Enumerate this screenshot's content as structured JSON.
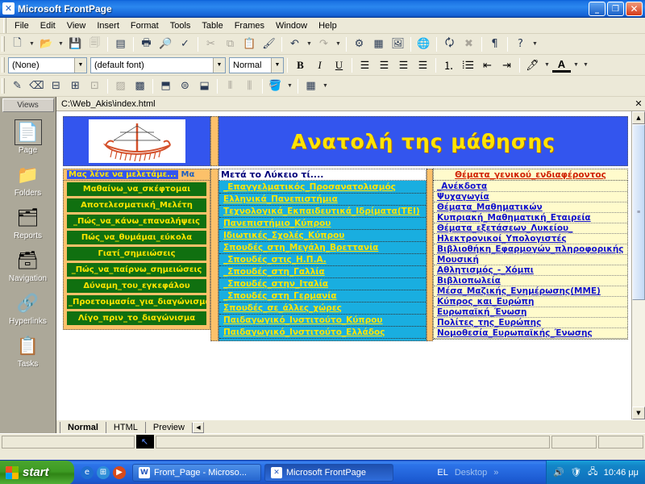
{
  "window": {
    "title": "Microsoft FrontPage",
    "icon": "frontpage-icon",
    "minimize": "_",
    "maximize": "❐",
    "close": "✕"
  },
  "menubar": {
    "items": [
      "File",
      "Edit",
      "View",
      "Insert",
      "Format",
      "Tools",
      "Table",
      "Frames",
      "Window",
      "Help"
    ]
  },
  "standard_toolbar": {
    "buttons": [
      {
        "name": "new-page-button",
        "glyph": "🗋"
      },
      {
        "name": "new-page-dropdown",
        "glyph": "▾"
      },
      {
        "name": "open-button",
        "glyph": "📂"
      },
      {
        "name": "open-dropdown",
        "glyph": "▾"
      },
      {
        "name": "save-button",
        "glyph": "💾"
      },
      {
        "name": "publish-button",
        "glyph": "🗐"
      },
      {
        "name": "folder-list-button",
        "glyph": "▤"
      },
      {
        "name": "print-button",
        "glyph": "🖨"
      },
      {
        "name": "print-preview-button",
        "glyph": "🔍"
      },
      {
        "name": "spelling-button",
        "glyph": "ABC"
      },
      {
        "name": "cut-button",
        "glyph": "✂"
      },
      {
        "name": "copy-button",
        "glyph": "⧉"
      },
      {
        "name": "paste-button",
        "glyph": "📋"
      },
      {
        "name": "format-painter-button",
        "glyph": "🖌"
      },
      {
        "name": "undo-button",
        "glyph": "↶"
      },
      {
        "name": "undo-dropdown",
        "glyph": "▾"
      },
      {
        "name": "redo-button",
        "glyph": "↷"
      },
      {
        "name": "redo-dropdown",
        "glyph": "▾"
      },
      {
        "name": "insert-component-button",
        "glyph": "⚙"
      },
      {
        "name": "insert-table-button",
        "glyph": "▦"
      },
      {
        "name": "insert-picture-button",
        "glyph": "🖼"
      },
      {
        "name": "hyperlink-button",
        "glyph": "🌐"
      },
      {
        "name": "refresh-button",
        "glyph": "🗘"
      },
      {
        "name": "stop-button",
        "glyph": "✖"
      },
      {
        "name": "show-paragraph-marks-button",
        "glyph": "¶"
      },
      {
        "name": "help-button",
        "glyph": "?"
      },
      {
        "name": "toolbar-options-dropdown",
        "glyph": "▾"
      }
    ]
  },
  "formatting_toolbar": {
    "style_combo": {
      "value": "(None)",
      "arrow": "▾"
    },
    "font_combo": {
      "value": "(default font)",
      "arrow": "▾"
    },
    "size_combo": {
      "value": "Normal",
      "arrow": "▾"
    },
    "buttons": [
      {
        "name": "bold-button",
        "glyph": "B"
      },
      {
        "name": "italic-button",
        "glyph": "I"
      },
      {
        "name": "underline-button",
        "glyph": "U"
      },
      {
        "name": "align-left-button",
        "glyph": "≡"
      },
      {
        "name": "align-center-button",
        "glyph": "≡"
      },
      {
        "name": "align-right-button",
        "glyph": "≡"
      },
      {
        "name": "justify-button",
        "glyph": "≡"
      },
      {
        "name": "numbered-list-button",
        "glyph": "⒈"
      },
      {
        "name": "bulleted-list-button",
        "glyph": "☰"
      },
      {
        "name": "decrease-indent-button",
        "glyph": "⇤"
      },
      {
        "name": "increase-indent-button",
        "glyph": "⇥"
      },
      {
        "name": "highlight-button",
        "glyph": "🖊"
      },
      {
        "name": "highlight-dropdown",
        "glyph": "▾"
      },
      {
        "name": "font-color-button",
        "glyph": "A"
      },
      {
        "name": "font-color-dropdown",
        "glyph": "▾"
      },
      {
        "name": "formatting-options-dropdown",
        "glyph": "▾"
      }
    ]
  },
  "tables_toolbar": {
    "buttons": [
      {
        "name": "draw-table-button",
        "glyph": "✎"
      },
      {
        "name": "eraser-button",
        "glyph": "⌫"
      },
      {
        "name": "insert-rows-button",
        "glyph": "⊟"
      },
      {
        "name": "insert-columns-button",
        "glyph": "⊞"
      },
      {
        "name": "delete-cells-button",
        "glyph": "⊠"
      },
      {
        "name": "merge-cells-button",
        "glyph": "▨"
      },
      {
        "name": "split-cells-button",
        "glyph": "▩"
      },
      {
        "name": "align-top-button",
        "glyph": "⬒"
      },
      {
        "name": "center-vertically-button",
        "glyph": "⬓"
      },
      {
        "name": "align-bottom-button",
        "glyph": "⬓"
      },
      {
        "name": "distribute-rows-button",
        "glyph": "⫴"
      },
      {
        "name": "distribute-columns-button",
        "glyph": "⫼"
      },
      {
        "name": "fill-color-button",
        "glyph": "🪣"
      },
      {
        "name": "fill-color-dropdown",
        "glyph": "▾"
      },
      {
        "name": "table-autoformat-button",
        "glyph": "▦"
      },
      {
        "name": "table-autoformat-dropdown",
        "glyph": "▾"
      }
    ]
  },
  "views_bar": {
    "caption": "Views",
    "items": [
      {
        "label": "Page",
        "icon": "page-view-icon",
        "glyph": "📄",
        "selected": true
      },
      {
        "label": "Folders",
        "icon": "folders-view-icon",
        "glyph": "📁",
        "selected": false
      },
      {
        "label": "Reports",
        "icon": "reports-view-icon",
        "glyph": "🗂",
        "selected": false
      },
      {
        "label": "Navigation",
        "icon": "navigation-view-icon",
        "glyph": "🗃",
        "selected": false
      },
      {
        "label": "Hyperlinks",
        "icon": "hyperlinks-view-icon",
        "glyph": "🔗",
        "selected": false
      },
      {
        "label": "Tasks",
        "icon": "tasks-view-icon",
        "glyph": "📋",
        "selected": false
      }
    ]
  },
  "document": {
    "path": "C:\\Web_Akis\\index.html",
    "close_glyph": "✕"
  },
  "webpage": {
    "banner_image_alt": "ancient-greek-ship-image",
    "title": "Ανατολή της μάθησης",
    "left_column": {
      "header_selected": "Μας λένε να μελετάμε...",
      "header_rest": "Μα",
      "items": [
        "Μαθαίνω_να_σκέφτομαι",
        "Αποτελεσματική_Μελέτη",
        "_Πώς_να_κάνω_επαναλήψεις",
        "Πώς_να_θυμάμαι_εύκολα",
        "Γιατί_σημειώσεις",
        "_Πώς_να_παίρνω_σημειώσεις",
        "Δύναμη_του_εγκεφάλου",
        "_Προετοιμασία_για_διαγώνισμα",
        "Λίγο_πριν_το_διαγώνισμα"
      ]
    },
    "middle_column": {
      "header": "Μετά το Λύκειο τί....",
      "items": [
        "_Επαγγελματικός_Προσανατολισμός",
        " Ελληνικά_Πανεπιστήμια",
        "Τεχνολογικά_Εκπαιδευτικά_Ιδρίματα(ΤΕΙ)",
        "Πανεπιστήμιο_Κύπρου",
        " Ιδιωτικές_Σχολές_Κύπρου",
        "Σπουδές_στη_Μεγάλη_Βρεττανία",
        "_Σπουδές_στις_Η.Π.Α.",
        "_Σπουδές_στη_Γαλλία",
        "_Σπουδές_στην_Ιταλία",
        "_Σπουδές_στη_Γερμανία",
        " Σπουδές_σε_άλλες_χώρες",
        "Παιδαγωγικό_Ινστιτούτο_Κύπρου",
        "Παιδαγωγικό_Ινστιτούτο_Ελλάδος"
      ]
    },
    "right_column": {
      "header": "Θέματα_γενικού_ενδιαφέροντος",
      "items": [
        "_Ανέκδοτα",
        "Ψυχαγωγία",
        "Θέματα_Μαθηματικών",
        "Κυπριακή_Μαθηματική_Εταιρεία",
        "Θέματα_εξετάσεων_Λυκείου_",
        "Ηλεκτρονικοί_Υπολογιστές",
        "Βιβλιοθήκη_Εφαρμογών_πληροφορικής",
        "Μουσική",
        "Αθλητισμός_-_Χόμπι",
        "Βιβλιοπωλεία",
        " Μέσα_Μαζικής_Ενημέρωσης(ΜΜΕ)",
        "Κύπρος_και_Ευρώπη",
        "Ευρωπαϊκή_Ένωση",
        "Πολίτες_της_Ευρώπης",
        "Νομοθεσία_Ευρωπαϊκής_Ένωσης"
      ]
    }
  },
  "page_tabs": {
    "items": [
      "Normal",
      "HTML",
      "Preview"
    ],
    "active": "Normal",
    "nav_glyph": "◀"
  },
  "vertical_scrollbar": {
    "up_glyph": "▲",
    "down_glyph": "▼",
    "thumb_grip": "≡"
  },
  "status_bar": {
    "icon": "pointer-icon",
    "icon_glyph": "↖"
  },
  "taskbar": {
    "start_label": "start",
    "quick_launch": [
      {
        "name": "internet-explorer-icon",
        "glyph": "e",
        "color": "#1f6fd0"
      },
      {
        "name": "show-desktop-icon",
        "glyph": "⊞",
        "color": "#2f8fd8"
      },
      {
        "name": "media-player-icon",
        "glyph": "▶",
        "color": "#d84a1b"
      }
    ],
    "tasks": [
      {
        "name": "task-frontpage-word",
        "label": "Front_Page - Microso...",
        "icon": "word-doc-icon",
        "icon_glyph": "W",
        "active": false
      },
      {
        "name": "task-microsoft-frontpage",
        "label": "Microsoft FrontPage",
        "icon": "frontpage-icon",
        "icon_glyph": "✕",
        "active": true
      }
    ],
    "language": "EL",
    "toolbar_label": "Desktop",
    "chevron": "»",
    "tray_icons": [
      {
        "name": "volume-icon",
        "glyph": "🔊"
      },
      {
        "name": "antivirus-icon",
        "glyph": "🛡"
      },
      {
        "name": "network-icon",
        "glyph": "🖧"
      }
    ],
    "clock": "10:46 μμ"
  },
  "colors": {
    "title_blue": "#1b72e2",
    "page_banner_blue": "#3355ee",
    "page_title_yellow": "#ffe400",
    "left_menu_orange": "#fcc16a",
    "left_button_green": "#107010",
    "middle_cyan": "#19aee0",
    "right_cream": "#fffbcc",
    "right_link_blue": "#1111cc",
    "right_header_red": "#d02000"
  }
}
